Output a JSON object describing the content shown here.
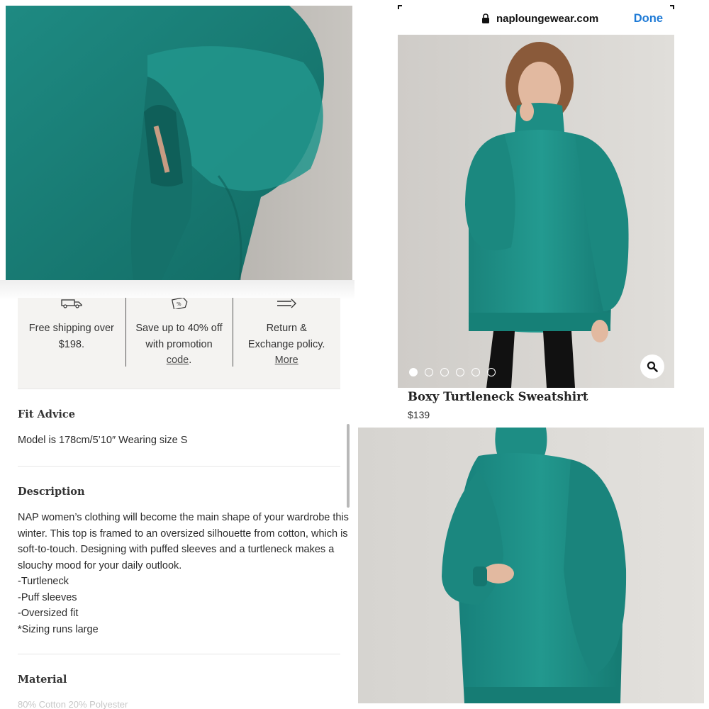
{
  "perks": [
    {
      "icon": "truck-icon",
      "lines": [
        "Free shipping over",
        "$198."
      ],
      "link": ""
    },
    {
      "icon": "tag-icon",
      "lines": [
        "Save up to 40% off",
        "with promotion"
      ],
      "link": "code",
      "link_suffix": "."
    },
    {
      "icon": "arrow-icon",
      "lines": [
        "Return &",
        "Exchange policy."
      ],
      "link": "More",
      "link_suffix": ""
    }
  ],
  "fit_advice": {
    "title": "Fit Advice",
    "text": "Model is 178cm/5’10″ Wearing size S"
  },
  "description": {
    "title": "Description",
    "lines": [
      "NAP women’s clothing will become the main shape of your wardrobe this",
      "winter. This top is framed to an oversized silhouette from cotton, which is",
      "soft-to-touch. Designing with puffed sleeves and a turtleneck makes a",
      "slouchy mood for your daily outlook.",
      "-Turtleneck",
      "-Puff sleeves",
      "-Oversized fit",
      "*Sizing runs large"
    ]
  },
  "material": {
    "title": "Material",
    "text": "80% Cotton 20% Polyester"
  },
  "browser": {
    "url": "naploungewear.com",
    "done_label": "Done"
  },
  "product": {
    "title": "Boxy Turtleneck Sweatshirt",
    "price": "$139",
    "image_count": 6,
    "active_image": 1
  },
  "colors": {
    "teal": "#1f8d85",
    "link_blue": "#1e7ad6",
    "perk_bg": "#f4f3f1"
  }
}
